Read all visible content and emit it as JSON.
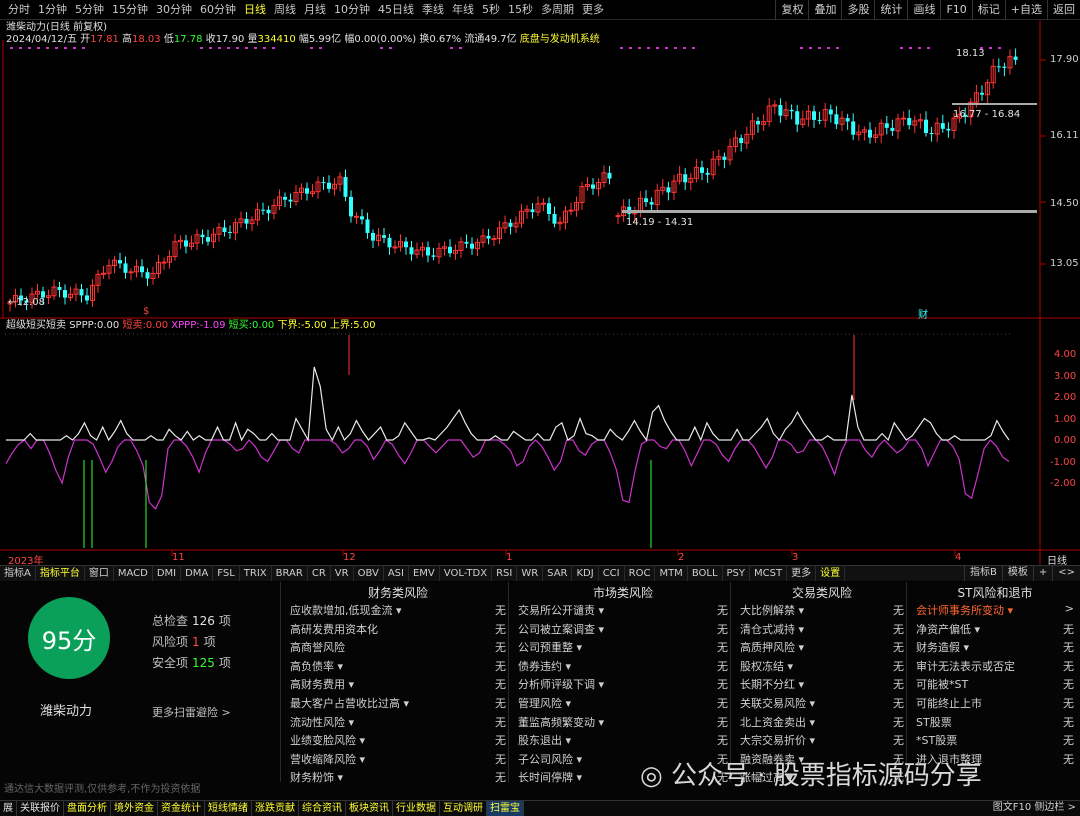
{
  "periods": [
    "分时",
    "1分钟",
    "5分钟",
    "15分钟",
    "30分钟",
    "60分钟",
    "日线",
    "周线",
    "月线",
    "10分钟",
    "45日线",
    "季线",
    "年线",
    "5秒",
    "15秒",
    "多周期",
    "更多"
  ],
  "active_period": "日线",
  "top_right_buttons": [
    "复权",
    "叠加",
    "多股",
    "统计",
    "画线",
    "F10",
    "标记",
    "+自选",
    "返回"
  ],
  "info": {
    "title": "潍柴动力(日线 前复权)",
    "date": "2024/04/12/五",
    "open_label": "开",
    "open": "17.81",
    "high_label": "高",
    "high": "18.03",
    "low_label": "低",
    "low": "17.78",
    "close_label": "收",
    "close": "17.90",
    "vol_label": "量",
    "vol": "334410",
    "pct_label": "幅",
    "pct": "5.99亿",
    "chg_label": "幅",
    "chg": "0.00(0.00%)",
    "turn_label": "换",
    "turn": "0.67%",
    "float_label": "流通",
    "float": "49.7亿",
    "sector": "底盘与发动机系统"
  },
  "price_axis": [
    "17.90",
    "16.11",
    "14.50",
    "13.05"
  ],
  "price_annotations": {
    "hi": "18.13",
    "range_hi": "16.77 - 16.84",
    "range_lo": "14.19 - 14.31",
    "lo": "12.08"
  },
  "indicator": {
    "name": "超级短买短卖",
    "sppp_label": "SPPP:",
    "sppp": "0.00",
    "dm_label": "短卖:",
    "dm": "0.00",
    "xppp_label": "XPPP:",
    "xppp": "-1.09",
    "bm_label": "短买:",
    "bm": "0.00",
    "lower_label": "下界:",
    "lower": "-5.00",
    "upper_label": "上界:",
    "upper": "5.00"
  },
  "ind_axis": [
    "4.00",
    "3.00",
    "2.00",
    "1.00",
    "0.00",
    "-1.00",
    "-2.00"
  ],
  "time_axis": [
    "2023年",
    "11",
    "12",
    "1",
    "2",
    "3",
    "4"
  ],
  "time_axis_right": "日线",
  "event_markers": {
    "m1": "$",
    "m2": "财"
  },
  "indicator_tabs": [
    "指标A",
    "指标平台",
    "窗口",
    "MACD",
    "DMI",
    "DMA",
    "FSL",
    "TRIX",
    "BRAR",
    "CR",
    "VR",
    "OBV",
    "ASI",
    "EMV",
    "VOL-TDX",
    "RSI",
    "WR",
    "SAR",
    "KDJ",
    "CCI",
    "ROC",
    "MTM",
    "BOLL",
    "PSY",
    "MCST",
    "更多",
    "设置"
  ],
  "indicator_tabs_active": [
    "指标平台",
    "设置"
  ],
  "tabs_right": [
    "指标B",
    "模板",
    "+",
    "<>"
  ],
  "scan": {
    "score": "95分",
    "name": "潍柴动力",
    "total_label": "总检查",
    "total": "126",
    "unit": "项",
    "risk_label": "风险项",
    "risk": "1",
    "safe_label": "安全项",
    "safe": "125",
    "more": "更多扫雷避险 >",
    "disclaimer": "通达信大数据评测,仅供参考,不作为投资依据"
  },
  "columns": [
    {
      "title": "财务类风险",
      "rows": [
        {
          "label": "应收款增加,低现金流 ▾",
          "value": "无"
        },
        {
          "label": "高研发费用资本化",
          "value": "无"
        },
        {
          "label": "高商誉风险",
          "value": "无"
        },
        {
          "label": "高负债率 ▾",
          "value": "无"
        },
        {
          "label": "高财务费用 ▾",
          "value": "无"
        },
        {
          "label": "最大客户占营收比过高 ▾",
          "value": "无"
        },
        {
          "label": "流动性风险 ▾",
          "value": "无"
        },
        {
          "label": "业绩变脸风险 ▾",
          "value": "无"
        },
        {
          "label": "营收缩降风险 ▾",
          "value": "无"
        },
        {
          "label": "财务粉饰 ▾",
          "value": "无"
        }
      ]
    },
    {
      "title": "市场类风险",
      "rows": [
        {
          "label": "交易所公开谴责 ▾",
          "value": "无"
        },
        {
          "label": "公司被立案调查 ▾",
          "value": "无"
        },
        {
          "label": "公司预重整 ▾",
          "value": "无"
        },
        {
          "label": "债券违约 ▾",
          "value": "无"
        },
        {
          "label": "分析师评级下调 ▾",
          "value": "无"
        },
        {
          "label": "管理风险 ▾",
          "value": "无"
        },
        {
          "label": "董监高频繁变动 ▾",
          "value": "无"
        },
        {
          "label": "股东退出 ▾",
          "value": "无"
        },
        {
          "label": "子公司风险 ▾",
          "value": "无"
        },
        {
          "label": "长时间停牌 ▾",
          "value": "无"
        }
      ]
    },
    {
      "title": "交易类风险",
      "rows": [
        {
          "label": "大比例解禁 ▾",
          "value": "无"
        },
        {
          "label": "清仓式减持 ▾",
          "value": "无"
        },
        {
          "label": "高质押风险 ▾",
          "value": "无"
        },
        {
          "label": "股权冻结 ▾",
          "value": "无"
        },
        {
          "label": "长期不分红 ▾",
          "value": "无"
        },
        {
          "label": "关联交易风险 ▾",
          "value": "无"
        },
        {
          "label": "北上资金卖出 ▾",
          "value": "无"
        },
        {
          "label": "大宗交易折价 ▾",
          "value": "无"
        },
        {
          "label": "融资融券卖 ▾",
          "value": "无"
        },
        {
          "label": "涨幅过高 ▾",
          "value": "无"
        }
      ]
    },
    {
      "title": "ST风险和退市",
      "rows": [
        {
          "label": "会计师事务所变动 ▾",
          "value": ">",
          "risk": true
        },
        {
          "label": "净资产偏低 ▾",
          "value": "无"
        },
        {
          "label": "财务造假 ▾",
          "value": "无"
        },
        {
          "label": "审计无法表示或否定",
          "value": "无"
        },
        {
          "label": "可能被*ST",
          "value": "无"
        },
        {
          "label": "可能终止上市",
          "value": "无"
        },
        {
          "label": "ST股票",
          "value": "无"
        },
        {
          "label": "*ST股票",
          "value": "无"
        },
        {
          "label": "进入退市整理",
          "value": "无"
        }
      ]
    }
  ],
  "bottom_tabs": [
    "展",
    "关联报价",
    "盘面分析",
    "境外资金",
    "资金统计",
    "短线情绪",
    "涨跌贡献",
    "综合资讯",
    "板块资讯",
    "行业数据",
    "互动调研",
    "扫雷宝"
  ],
  "bottom_tabs_yellow": [
    "盘面分析",
    "境外资金",
    "资金统计",
    "短线情绪",
    "涨跌贡献",
    "综合资讯",
    "板块资讯",
    "行业数据",
    "互动调研"
  ],
  "bottom_active": "扫雷宝",
  "bottom_right": "图文F10 侧边栏 >",
  "watermark": "公众号 · 股票指标源码分享",
  "colors": {
    "up": "#ff3333",
    "down": "#33ffff",
    "accent": "#ffff33",
    "score": "#0aa05a",
    "risk": "#ff6633"
  }
}
